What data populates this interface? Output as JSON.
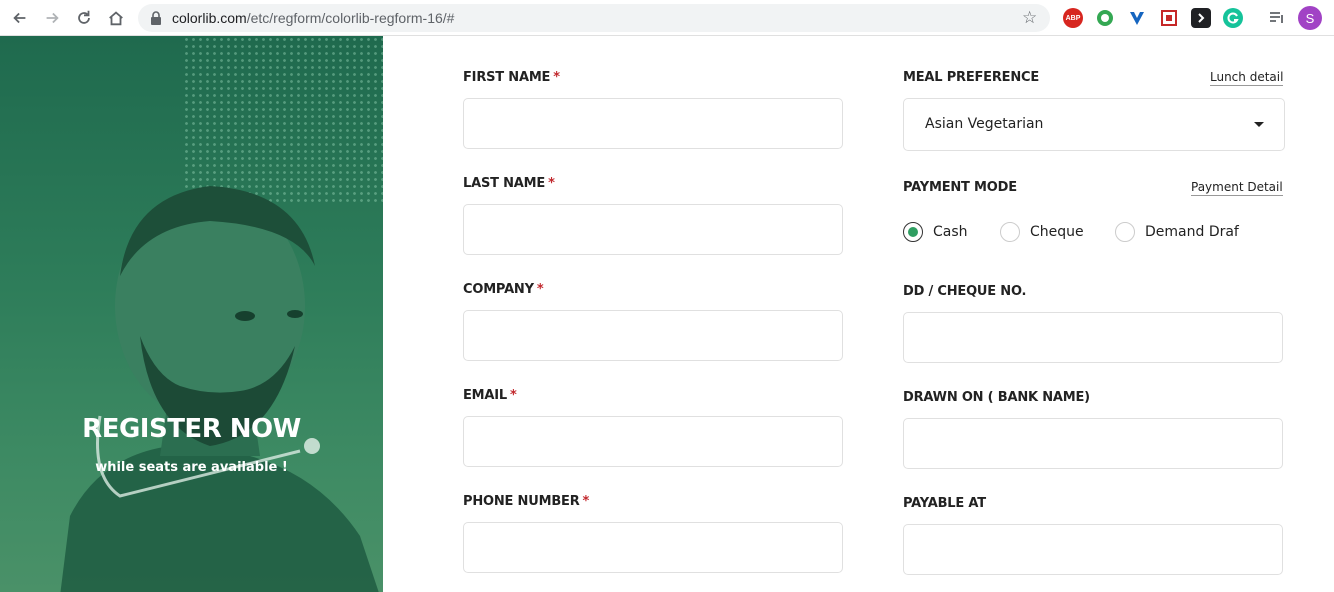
{
  "browser": {
    "url_host": "colorlib.com",
    "url_path": "/etc/regform/colorlib-regform-16/#",
    "profile_initial": "S",
    "extensions": [
      "adblock-plus-icon",
      "green-circle-icon",
      "blue-v-icon",
      "red-square-icon",
      "dark-chevron-icon",
      "grammarly-icon",
      "reading-list-icon"
    ],
    "abp_label": "ABP"
  },
  "hero": {
    "title": "REGISTER NOW",
    "subtitle": "while seats are available !"
  },
  "form": {
    "left": {
      "first_name": "FIRST NAME",
      "last_name": "LAST NAME",
      "company": "COMPANY",
      "email": "EMAIL",
      "phone": "PHONE NUMBER",
      "required_mark": "*"
    },
    "right": {
      "meal_label": "MEAL PREFERENCE",
      "meal_link": "Lunch detail",
      "meal_value": "Asian Vegetarian",
      "payment_label": "PAYMENT MODE",
      "payment_link": "Payment Detail",
      "payment_options": [
        "Cash",
        "Cheque",
        "Demand Draf"
      ],
      "payment_selected": "Cash",
      "dd_label": "DD / CHEQUE NO.",
      "drawn_label": "DRAWN ON ( BANK NAME)",
      "payable_label": "PAYABLE AT"
    }
  },
  "colors": {
    "accent": "#2f9e61",
    "required": "#c2292e",
    "hero_green": "#2e7d5a"
  }
}
